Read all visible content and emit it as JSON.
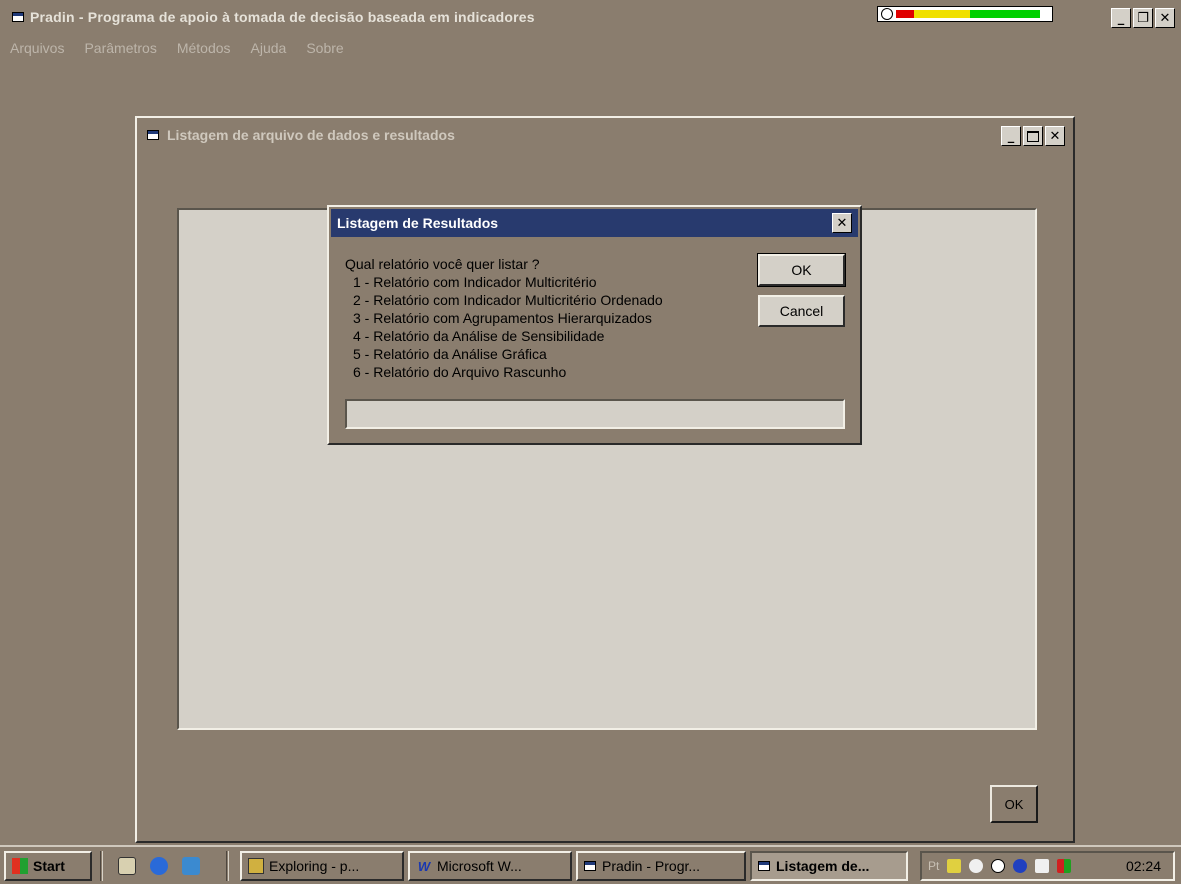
{
  "app": {
    "title": "Pradin - Programa de apoio à tomada de decisão baseada em indicadores",
    "minimize_glyph": "_",
    "restore_glyph": "❐",
    "close_glyph": "✕",
    "meter_colors": [
      "#e00000",
      "#f0e000",
      "#00d000"
    ]
  },
  "menu": [
    "Arquivos",
    "Parâmetros",
    "Métodos",
    "Ajuda",
    "Sobre"
  ],
  "child_window": {
    "title": "Listagem de arquivo de dados e resultados",
    "ok_label": "OK"
  },
  "dialog": {
    "title": "Listagem de Resultados",
    "close_glyph": "✕",
    "prompt": "Qual relatório você quer listar ?",
    "options": [
      "1 - Relatório com Indicador Multicritério",
      "2 - Relatório com Indicador Multicritério Ordenado",
      "3 - Relatório com Agrupamentos Hierarquizados",
      "4 - Relatório da Análise de Sensibilidade",
      "5 - Relatório da Análise Gráfica",
      "6 - Relatório do Arquivo Rascunho"
    ],
    "ok_label": "OK",
    "cancel_label": "Cancel",
    "input_value": ""
  },
  "taskbar": {
    "start_label": "Start",
    "buttons": [
      "Exploring - p...",
      "Microsoft W...",
      "Pradin - Progr...",
      "Listagem de..."
    ],
    "tray_lang": "Pt",
    "clock": "02:24"
  }
}
